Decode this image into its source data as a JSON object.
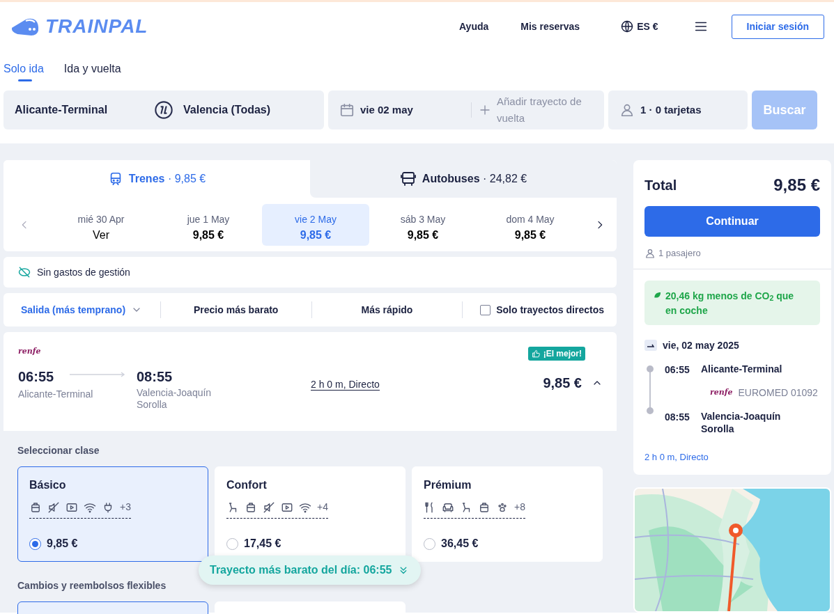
{
  "header": {
    "logo_text": "TRAINPAL",
    "nav": [
      "Ayuda",
      "Mis reservas"
    ],
    "language": "ES €",
    "login": "Iniciar sesión"
  },
  "trip_tabs": [
    {
      "label": "Solo ida",
      "selected": true
    },
    {
      "label": "Ida y vuelta",
      "selected": false
    }
  ],
  "search": {
    "origin": "Alicante-Terminal",
    "destination": "Valencia (Todas)",
    "date": "vie 02 may",
    "return_placeholder": "Añadir trayecto de vuelta",
    "passengers": "1 · 0 tarjetas",
    "button": "Buscar",
    "disabled": true
  },
  "mode_tabs": [
    {
      "kind": "train",
      "label": "Trenes",
      "price": "· 9,85 €",
      "selected": true
    },
    {
      "kind": "bus",
      "label": "Autobuses",
      "price": "· 24,82 €",
      "selected": false
    }
  ],
  "dates": [
    {
      "day": "mié 30 Apr",
      "price": "Ver",
      "selected": false
    },
    {
      "day": "jue 1 May",
      "price": "9,85 €",
      "selected": false
    },
    {
      "day": "vie 2 May",
      "price": "9,85 €",
      "selected": true
    },
    {
      "day": "sáb 3 May",
      "price": "9,85 €",
      "selected": false
    },
    {
      "day": "dom 4 May",
      "price": "9,85 €",
      "selected": false
    }
  ],
  "notice": "Sin gastos de gestión",
  "sort": {
    "options": [
      {
        "label": "Salida (más temprano)",
        "selected": true
      },
      {
        "label": "Precio más barato",
        "selected": false
      },
      {
        "label": "Más rápido",
        "selected": false
      }
    ],
    "direct_only": {
      "label": "Solo trayectos directos",
      "checked": false
    }
  },
  "journey": {
    "operator": "renfe",
    "badge": "¡El mejor!",
    "departure_time": "06:55",
    "departure_station": "Alicante-Terminal",
    "arrival_time": "08:55",
    "arrival_station": "Valencia-Joaquín Sorolla",
    "duration": "2 h 0 m, Directo",
    "price": "9,85 €",
    "expanded": true
  },
  "class_section": {
    "title": "Seleccionar clase",
    "classes": [
      {
        "name": "Básico",
        "amenities": [
          {
            "kind": "luggage"
          },
          {
            "kind": "quiet"
          },
          {
            "kind": "video"
          },
          {
            "kind": "wifi"
          },
          {
            "kind": "plug"
          }
        ],
        "more": "+3",
        "price": "9,85 €",
        "selected": true
      },
      {
        "name": "Confort",
        "amenities": [
          {
            "kind": "seat"
          },
          {
            "kind": "luggage"
          },
          {
            "kind": "quiet"
          },
          {
            "kind": "video"
          },
          {
            "kind": "wifi"
          }
        ],
        "more": "+4",
        "price": "17,45 €",
        "selected": false
      },
      {
        "name": "Prémium",
        "amenities": [
          {
            "kind": "meal"
          },
          {
            "kind": "lounge"
          },
          {
            "kind": "seat"
          },
          {
            "kind": "luggage"
          },
          {
            "kind": "pet"
          }
        ],
        "more": "+8",
        "price": "36,45 €",
        "selected": false
      }
    ]
  },
  "flex_section": {
    "title": "Cambios y reembolsos flexibles",
    "options": [
      {
        "selected": true
      },
      {
        "selected": false
      }
    ]
  },
  "cheapest_banner": "Trayecto más barato del día: 06:55",
  "summary": {
    "total_label": "Total",
    "total": "9,85 €",
    "button": "Continuar",
    "passengers": "1 pasajero",
    "co2": "20,46 kg menos de CO$_{2}$ que en coche",
    "date": "vie, 02 may 2025",
    "stops": [
      {
        "time": "06:55",
        "station": "Alicante-Terminal"
      },
      {
        "time": "08:55",
        "station": "Valencia-Joaquín Sorolla"
      }
    ],
    "operator": "renfe",
    "train": "EUROMED 01092",
    "duration": "2 h 0 m, Directo"
  }
}
